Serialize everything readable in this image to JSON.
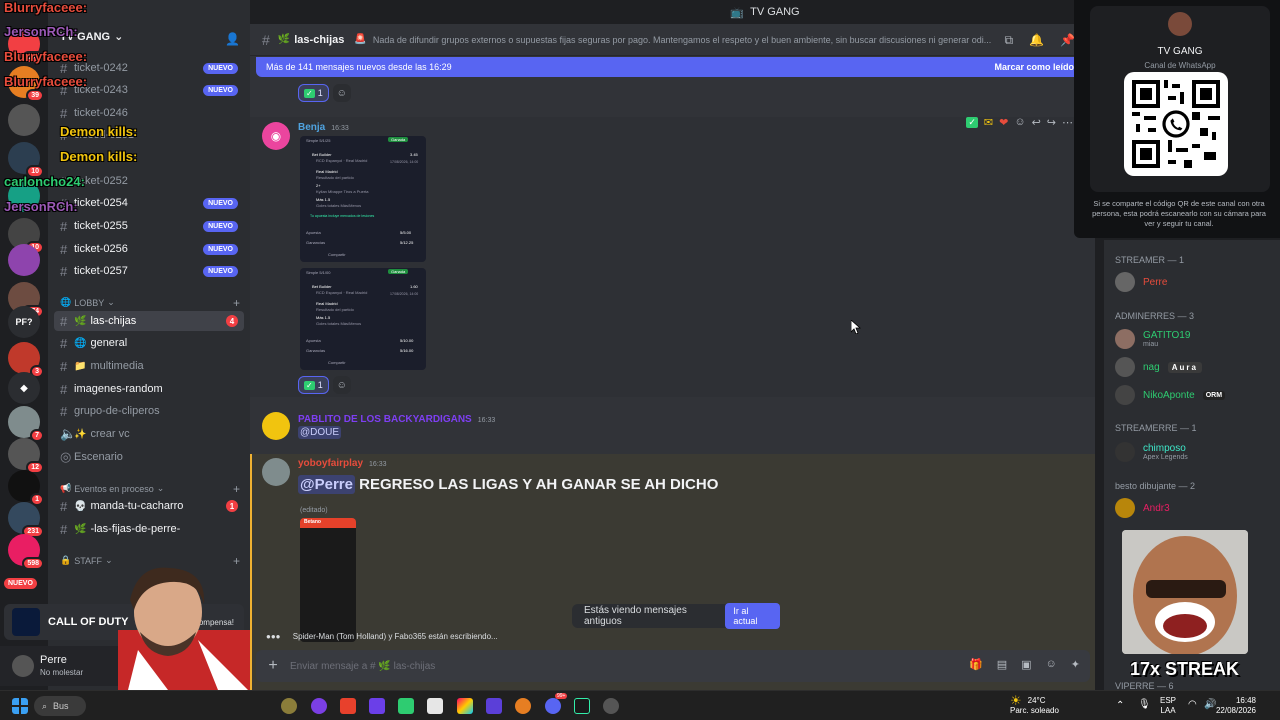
{
  "window": {
    "title": "TV GANG"
  },
  "server": {
    "name": "TV GANG"
  },
  "channels_top": [
    {
      "name": "ticket-0242",
      "badge": "NUEVO"
    },
    {
      "name": "ticket-0243",
      "badge": "NUEVO"
    },
    {
      "name": "ticket-0246",
      "badge": ""
    },
    {
      "name": "closed-0251",
      "badge": ""
    },
    {
      "name": "ticket-0252",
      "badge": ""
    },
    {
      "name": "ticket-0254",
      "badge": "NUEVO"
    },
    {
      "name": "ticket-0255",
      "badge": "NUEVO"
    },
    {
      "name": "ticket-0256",
      "badge": "NUEVO"
    },
    {
      "name": "ticket-0257",
      "badge": "NUEVO"
    }
  ],
  "category_lobby": "LOBBY",
  "channels_lobby": [
    {
      "name": "las-chijas",
      "count": "4"
    },
    {
      "name": "general",
      "count": ""
    },
    {
      "name": "multimedia",
      "count": ""
    },
    {
      "name": "imagenes-random",
      "count": ""
    },
    {
      "name": "grupo-de-cliperos",
      "count": ""
    },
    {
      "name": "crear vc",
      "count": ""
    },
    {
      "name": "Escenario",
      "count": ""
    }
  ],
  "category_events": "Eventos en proceso",
  "channels_events": [
    {
      "name": "manda-tu-cacharro",
      "count": "1"
    },
    {
      "name": "-las-fijas-de-perre-",
      "count": ""
    }
  ],
  "category_staff": "STAFF",
  "stream_overlay": {
    "chat_names": [
      "Blurryfaceee:",
      "JersonRCh:",
      "Blurryfaceee:",
      "Blurryfaceee:",
      "Demon kills:",
      "Demon kills:",
      "carloncho24:",
      "JersonRCh:"
    ]
  },
  "server_badges": [
    "99+",
    "39",
    "10",
    "10",
    "674",
    "3",
    "7",
    "12",
    "1",
    "231",
    "598"
  ],
  "server_labels": [
    "PF?",
    "NUEVO"
  ],
  "now_playing": {
    "title": "CALL OF DUTY",
    "text": "ecompensa!"
  },
  "user": {
    "name": "Perre",
    "status": "No molestar"
  },
  "chat": {
    "channel": "las-chijas",
    "topic": "Nada de difundir grupos externos o supuestas fijas seguras por pago. Mantengamos el respeto y el buen ambiente, sin buscar discusiones ni generar odi...",
    "new_messages": "Más de 141 mensajes nuevos desde las 16:29",
    "mark_read": "Marcar como leído",
    "reaction_count": "1",
    "messages": [
      {
        "author": "Benja",
        "time": "16:33",
        "author_color": "#4fa3e0"
      },
      {
        "author": "PABLITO DE LOS BACKYARDIGANS",
        "time": "16:33",
        "author_color": "#7e3ff2",
        "mention": "@DOUE"
      },
      {
        "author": "yoboyfairplay",
        "time": "16:33",
        "author_color": "#e74c3c",
        "mention": "@Perre",
        "text": "REGRESO LAS LIGAS Y AH GANAR SE AH DICHO",
        "edited": "(editado)"
      }
    ],
    "bet_cards": [
      {
        "header": "Simple 5/1/25",
        "status": "Ganada",
        "builder": "Bet Builder",
        "odds": "3.45",
        "match": "RCD Espanyol · Real Madrid",
        "date": "17/08/2026, 14:00",
        "legs": [
          "Real Madrid",
          "Resultado del partido",
          "2+",
          "Kylian Mbappe Tiros a Puerta",
          "Más 1.5",
          "Goles totales Más/Menos"
        ],
        "note": "Tu apuesta incluye mercados de lesiones",
        "stake_label": "Apuesta",
        "stake": "5/5.00",
        "win_label": "Ganancias",
        "win": "5/12.25",
        "share": "Compartir"
      },
      {
        "header": "Simple 5/1/00",
        "status": "Ganada",
        "builder": "Bet Builder",
        "odds": "1.60",
        "match": "RCD Espanyol · Real Madrid",
        "date": "17/08/2026, 14:00",
        "legs": [
          "Real Madrid",
          "Resultado del partido",
          "Más 1.5",
          "Goles totales Más/Menos"
        ],
        "stake_label": "Apuesta",
        "stake": "5/10.00",
        "win_label": "Ganancias",
        "win": "5/16.00",
        "share": "Compartir"
      }
    ],
    "phone_brand": "Betano",
    "old_banner": "Estás viendo mensajes antiguos",
    "go_current": "Ir al actual",
    "typing": "Spider-Man (Tom Holland) y Fabo365 están escribiendo...",
    "composer_placeholder": "Enviar mensaje a #",
    "composer_channel": "las-chijas"
  },
  "qr": {
    "title": "TV GANG",
    "subtitle": "Canal de WhatsApp",
    "note": "Si se comparte el código QR de este canal con otra persona, esta podrá escanearlo con su cámara para ver y seguir tu canal."
  },
  "members": {
    "groups": [
      {
        "label": "STREAMER — 1",
        "members": [
          {
            "name": "Perre",
            "color": "#e74c3c",
            "sub": ""
          }
        ]
      },
      {
        "label": "ADMINERRES — 3",
        "members": [
          {
            "name": "GATITO19",
            "color": "#2ecc71",
            "sub": "miau"
          },
          {
            "name": "nag",
            "color": "#2ecc71",
            "sub": "",
            "tag": "Aura"
          },
          {
            "name": "NikoAponte",
            "color": "#2ecc71",
            "sub": "",
            "tag": "ORM"
          }
        ]
      },
      {
        "label": "STREAMERRE — 1",
        "members": [
          {
            "name": "chimposo",
            "color": "#3ee8c9",
            "sub": "Apex Legends"
          }
        ]
      },
      {
        "label": "besto dibujante — 2",
        "members": [
          {
            "name": "Andr3",
            "color": "#e91e63",
            "sub": ""
          }
        ]
      },
      {
        "label": "VIPERRE — 6",
        "members": []
      }
    ]
  },
  "overlay": {
    "streak": "17x STREAK"
  },
  "taskbar": {
    "search": "Bus",
    "weather_temp": "24°C",
    "weather_text": "Parc. soleado",
    "lang1": "ESP",
    "lang2": "LAA",
    "time": "16:48",
    "date": "22/08/2026",
    "discord_badge": "99+"
  },
  "colors": {
    "accent": "#5865f2",
    "danger": "#f23f43",
    "highlight": "#f0b232"
  }
}
